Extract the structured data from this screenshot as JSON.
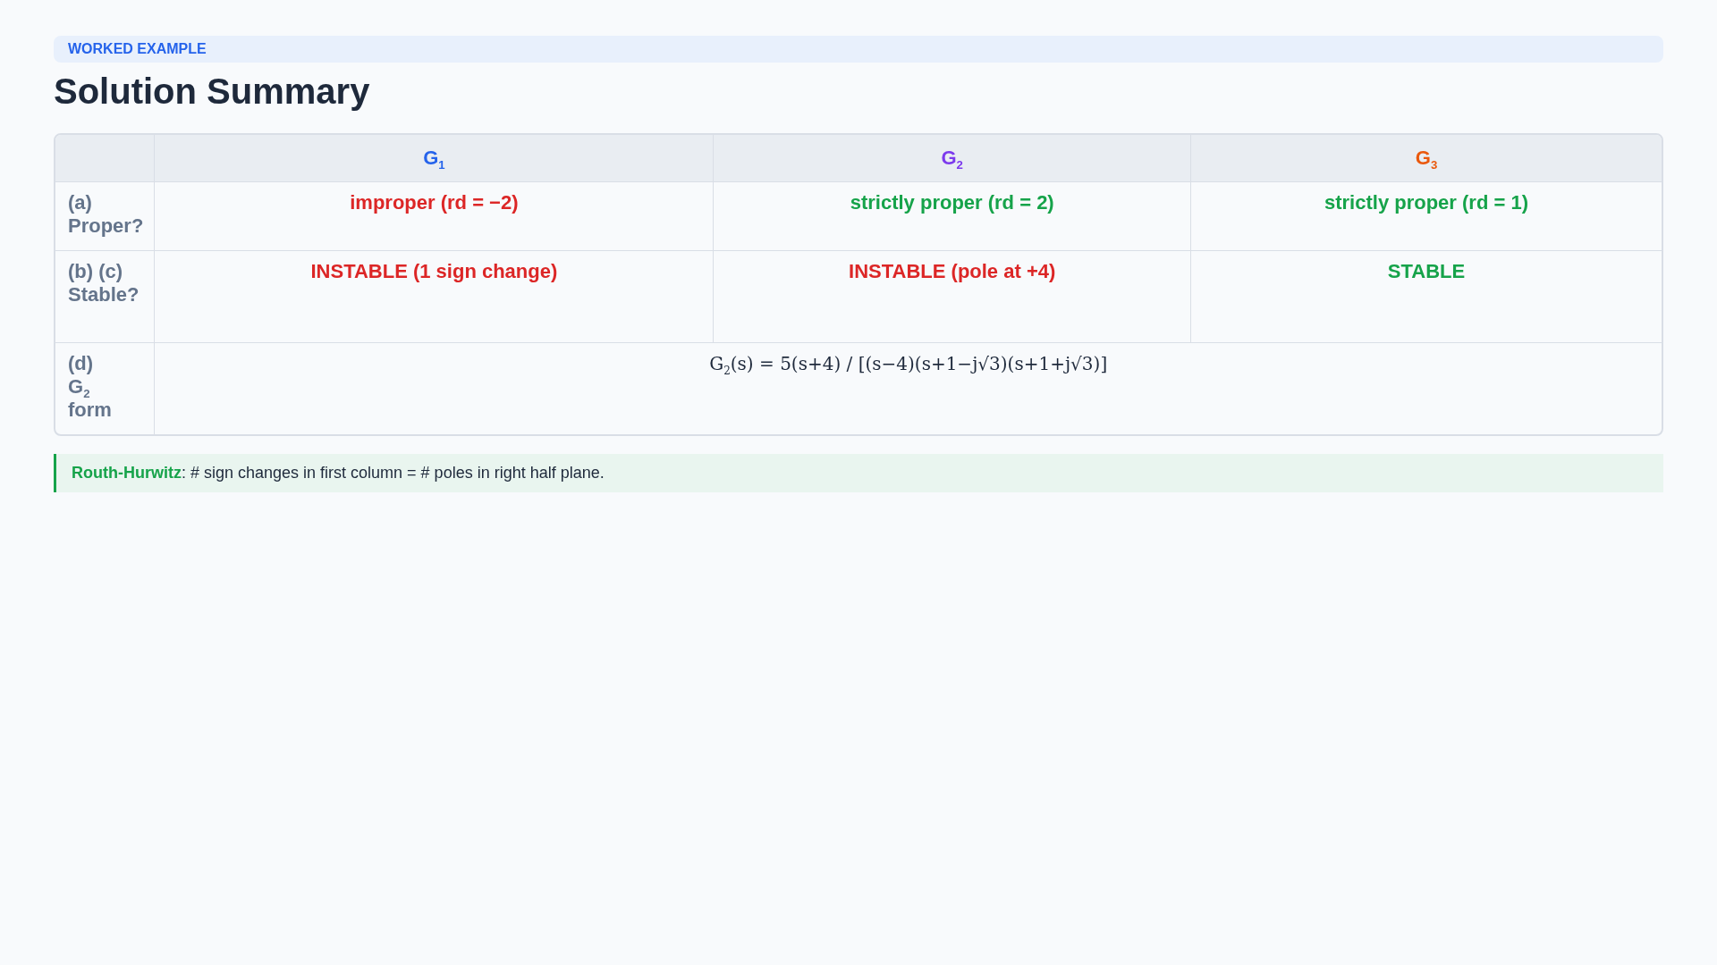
{
  "banner": {
    "label": "WORKED EXAMPLE"
  },
  "title": "Solution Summary",
  "table": {
    "columns": [
      {
        "label": "G$_{1}$",
        "color": "#2563eb"
      },
      {
        "label": "G$_{2}$",
        "color": "#7c3aed"
      },
      {
        "label": "G$_{3}$",
        "color": "#ea580c"
      }
    ],
    "rows": [
      {
        "label": "(a) Proper?",
        "kind": "cells",
        "cells": [
          {
            "text": "improper (rd = −2)",
            "color": "#dc2626"
          },
          {
            "text": "strictly proper (rd = 2)",
            "color": "#16a34a"
          },
          {
            "text": "strictly proper (rd = 1)",
            "color": "#16a34a"
          }
        ]
      },
      {
        "label": "(b) (c) Stable?",
        "kind": "cells",
        "cells": [
          {
            "text": "INSTABLE (1 sign change)",
            "color": "#dc2626"
          },
          {
            "text": "INSTABLE (pole at +4)",
            "color": "#dc2626"
          },
          {
            "text": "STABLE",
            "color": "#16a34a"
          }
        ]
      },
      {
        "label": "(d) G$_{2}$ form",
        "kind": "formula",
        "formula": "G$_{2}$(s) = 5(s+4) / [(s−4)(s+1−j√3)(s+1+j√3)]"
      }
    ]
  },
  "note": "**Routh-Hurwitz**: # sign changes in first column = # poles in right half plane."
}
